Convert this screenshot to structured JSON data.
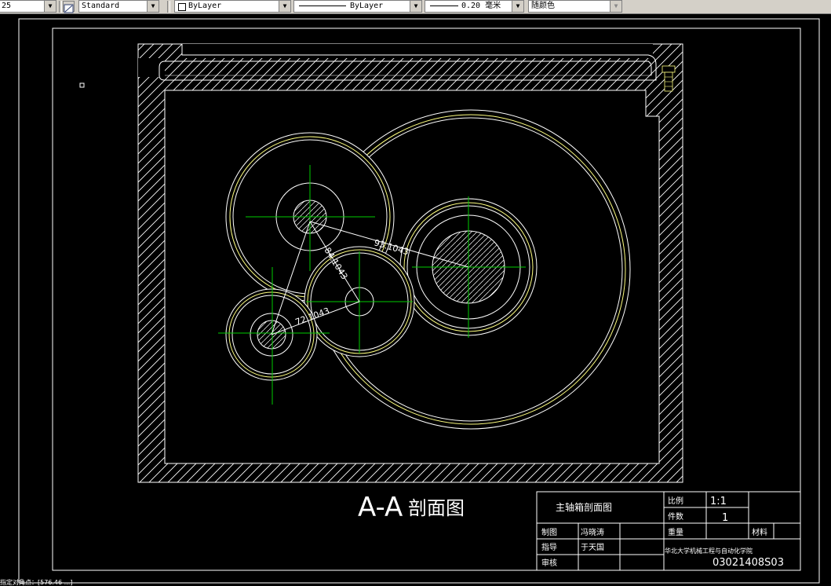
{
  "toolbar": {
    "text_height": "25",
    "dim_style": "Standard",
    "layer": "ByLayer",
    "linetype": "ByLayer",
    "lineweight": "0.20 毫米",
    "plot_color": "随颜色"
  },
  "drawing": {
    "section_title": "A-A",
    "section_subtitle": "剖面图",
    "dimensions": [
      "93.1043",
      "84.1043",
      "72.1043"
    ],
    "title_block": {
      "part_name": "主轴箱剖面图",
      "scale_label": "比例",
      "scale_value": "1:1",
      "quantity_label": "件数",
      "quantity_value": "1",
      "weight_label": "重量",
      "material_label": "材料",
      "drawn_label": "制图",
      "drawn_name": "冯晓涛",
      "supervisor_label": "指导",
      "supervisor_name": "于天国",
      "review_label": "审核",
      "school": "华北大学机械工程与自动化学院",
      "drawing_number": "03021408S03"
    }
  },
  "command_line": "指定对角点：[576.46 ...]",
  "colors": {
    "background": "#000000",
    "lines": "#ffffff",
    "gear_outline": "#ffff80",
    "centerline": "#00cc00",
    "toolbar": "#d4d0c8"
  }
}
